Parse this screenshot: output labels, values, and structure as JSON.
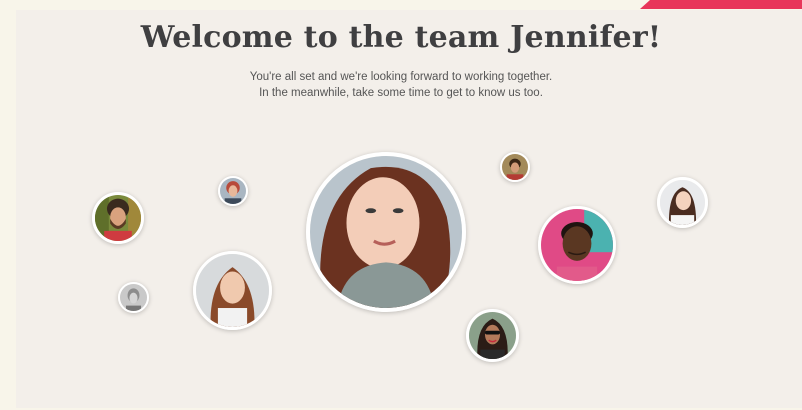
{
  "heading": "Welcome to the team Jennifer!",
  "subtitle": {
    "line1": "You're all set and we're looking forward to working together.",
    "line2": "In the meanwhile, take some time to get to know us too."
  },
  "colors": {
    "accent": "#e8365a",
    "background": "#f3efea",
    "heading": "#3f3f41"
  }
}
